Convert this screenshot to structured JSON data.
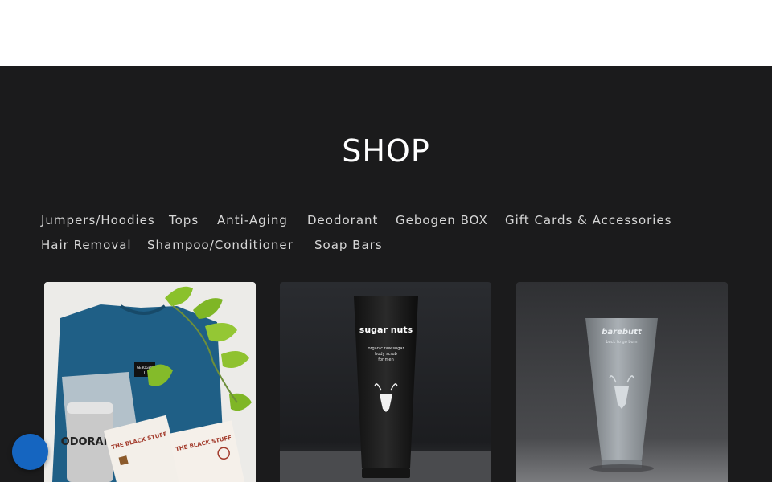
{
  "shop": {
    "title": "SHOP",
    "categories": [
      "Jumpers/Hoodies",
      "Tops",
      "Anti-Aging",
      "Deodorant",
      "Gebogen BOX",
      "Gift Cards & Accessories",
      "Hair Removal",
      "Shampoo/Conditioner",
      "Soap Bars"
    ],
    "products": [
      {
        "sweater_tag": "GEBOGEN",
        "sweater_size": "L",
        "deodorant_text": "ODORANT",
        "pack_left_text": "THE BLACK STUFF",
        "pack_right_text": "THE BLACK STUFF"
      },
      {
        "brand": "sugar nuts",
        "line1": "organic raw sugar",
        "line2": "body scrub",
        "line3": "for men"
      },
      {
        "brand": "barebutt",
        "line1": "back to go bum"
      }
    ]
  },
  "colors": {
    "section_bg": "#1b1b1c",
    "title_text": "#ffffff",
    "category_text": "#d7d7d7",
    "chat_button": "#1565c0"
  },
  "icons": {
    "chat_button": "chat-icon"
  }
}
